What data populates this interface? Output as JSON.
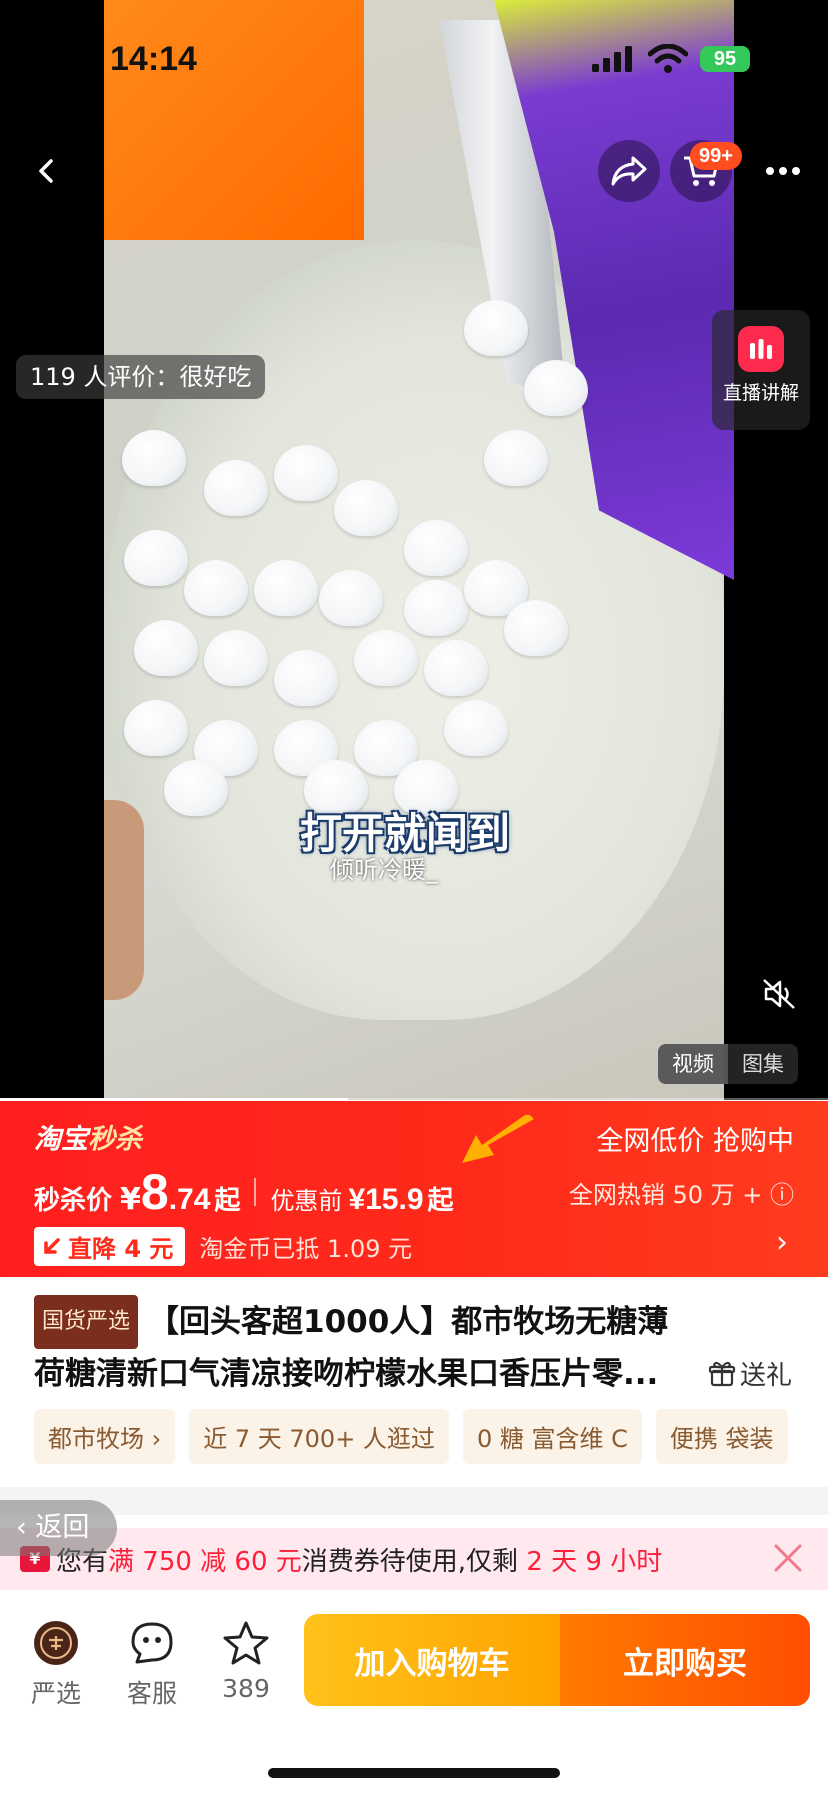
{
  "status_bar": {
    "time": "14:14",
    "battery": "95"
  },
  "header": {
    "cart_badge": "99+"
  },
  "media": {
    "review_chip": "119 人评价：很好吃",
    "live_label": "直播讲解",
    "caption_main": "打开就闻到",
    "caption_sub": "倾听冷暖_",
    "tabs": [
      {
        "label": "视频",
        "active": true
      },
      {
        "label": "图集",
        "active": false
      }
    ],
    "video_progress": 0.42
  },
  "flash_sale": {
    "logo_a": "淘宝",
    "logo_b": "秒杀",
    "tagline": "全网低价 抢购中",
    "hot_sales": "全网热销 50 万 + ⓘ",
    "price_label": "秒杀价",
    "currency": "¥",
    "price_int": "8",
    "price_dec": ".74",
    "price_suffix": "起",
    "before_label": "优惠前",
    "before_value": "¥15.9",
    "before_suffix": "起",
    "drop_label": "直降 4 元",
    "coin_text": "淘金币已抵 1.09 元",
    "colors": {
      "banner": "#ff1f1f",
      "accent": "#ffe3a8"
    }
  },
  "product": {
    "badge": "国货严选",
    "title": "【回头客超1000人】都市牧场无糖薄荷糖清新口气清凉接吻柠檬水果口香压片零...",
    "gift_label": "送礼",
    "tags": [
      "都市牧场 ›",
      "近 7 天 700+ 人逛过",
      "0 糖 富含维 C",
      "便携 袋装"
    ]
  },
  "back": {
    "label": "返回"
  },
  "coupon": {
    "icon": "¥",
    "text_a": "您有",
    "text_b": "满 750 减 60 元",
    "text_c": "消费券待使用,仅剩",
    "text_d": "2 天 9 小时"
  },
  "bottom_bar": {
    "items": [
      {
        "label": "严选",
        "icon": "shop-icon"
      },
      {
        "label": "客服",
        "icon": "service-icon"
      },
      {
        "label": "389",
        "icon": "star-icon"
      }
    ],
    "cart_button": "加入购物车",
    "buy_button": "立即购买",
    "colors": {
      "cart": "#ffa300",
      "buy": "#ff5a00"
    }
  }
}
